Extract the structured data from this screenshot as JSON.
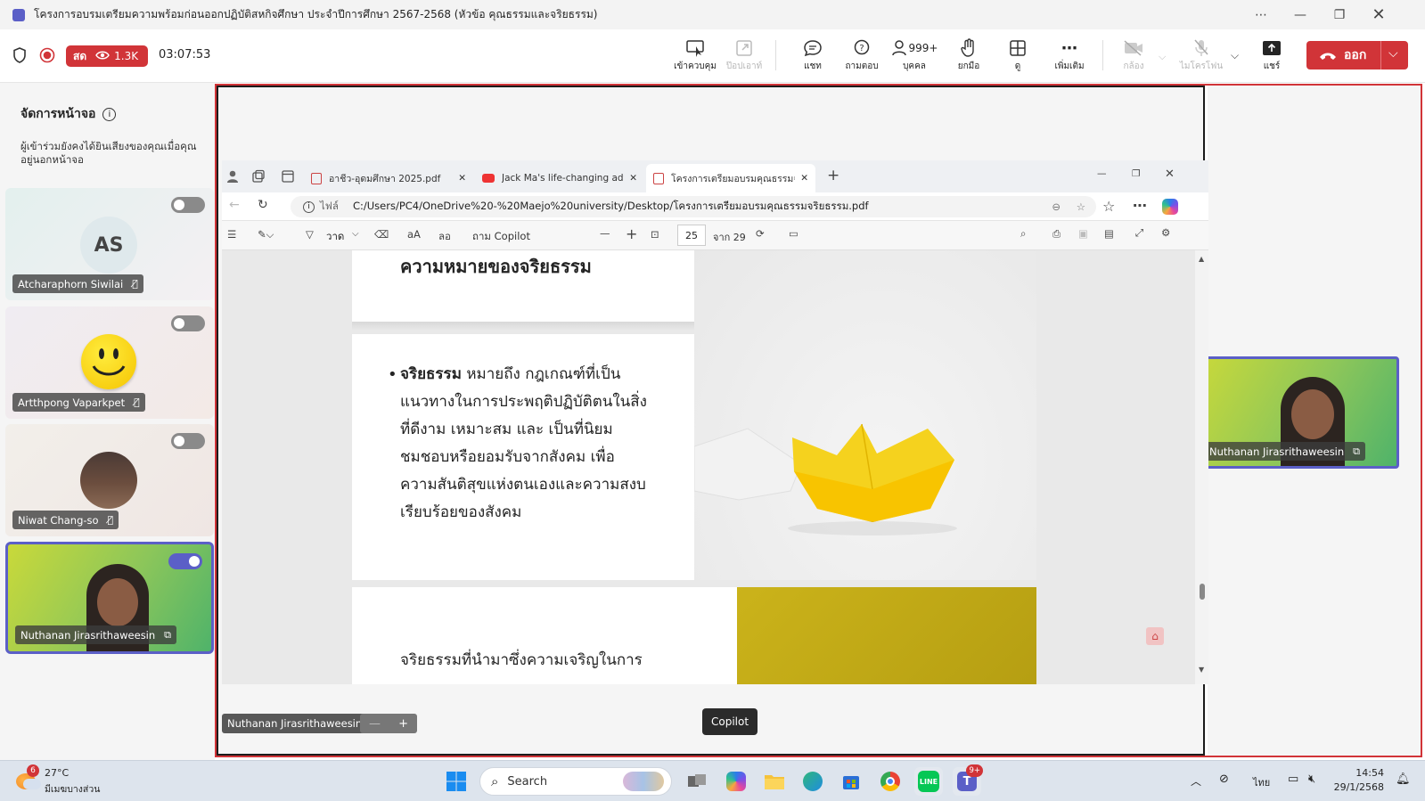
{
  "window": {
    "title": "โครงการอบรมเตรียมความพร้อมก่อนออกปฏิบัติสหกิจศึกษา ประจำปีการศึกษา 2567-2568 (หัวข้อ คุณธรรมและจริยธรรม)"
  },
  "meeting": {
    "live_label": "สด",
    "viewers": "1.3K",
    "timer": "03:07:53",
    "buttons": {
      "control": "เข้าควบคุม",
      "popout": "ป๊อปเอาท์",
      "chat": "แชท",
      "qa": "ถามตอบ",
      "people_count": "999+",
      "people": "บุคคล",
      "raise_hand": "ยกมือ",
      "view": "ดู",
      "more": "เพิ่มเติม",
      "camera": "กล้อง",
      "mic": "ไมโครโฟน",
      "share": "แชร์",
      "leave": "ออก"
    }
  },
  "left_panel": {
    "title": "จัดการหน้าจอ",
    "description": "ผู้เข้าร่วมยังคงได้ยินเสียงของคุณเมื่อคุณอยู่นอกหน้าจอ",
    "participants": [
      {
        "name": "Atcharaphorn Siwilai",
        "initials": "AS",
        "toggle_on": false
      },
      {
        "name": "Artthpong Vaparkpet",
        "toggle_on": false
      },
      {
        "name": "Niwat Chang-so",
        "toggle_on": false
      },
      {
        "name": "Nuthanan Jirasrithaweesin",
        "toggle_on": true
      }
    ]
  },
  "stage": {
    "presenter_name": "Nuthanan Jirasrithaweesin",
    "zoom_minus": "—",
    "zoom_plus": "+",
    "tooltip": "Copilot"
  },
  "browser": {
    "tabs": [
      {
        "label": "อาชีว-อุดมศึกษา 2025.pdf"
      },
      {
        "label": "Jack Ma's life-changing advice fo"
      },
      {
        "label": "โครงการเตรียมอบรมคุณธรรมจริยธรร"
      }
    ],
    "address_prefix": "ไฟล์",
    "url": "C:/Users/PC4/OneDrive%20-%20Maejo%20university/Desktop/โครงการเตรียมอบรมคุณธรรมจริยธรรม.pdf",
    "pdf_toolbar": {
      "draw": "วาด",
      "read_aloud": "aA",
      "translate": "ลอ",
      "copilot": "ถาม Copilot",
      "page": "25",
      "of_pages": "จาก 29"
    },
    "slide": {
      "heading": "ความหมายของจริยธรรม",
      "bullet_term": "จริยธรรม",
      "bullet_lines": [
        "หมายถึง กฎเกณฑ์ที่เป็น",
        "แนวทางในการประพฤติปฏิบัติตนในสิ่ง",
        "ที่ดีงาม เหมาะสม และ เป็นที่นิยม",
        "ชมชอบหรือยอมรับจากสังคม เพื่อ",
        "ความสันติสุขแห่งตนเองและความสงบ",
        "เรียบร้อยของสังคม"
      ],
      "next_slide_text": "จริยธรรมที่นำมาซึ่งความเจริญในการ"
    }
  },
  "right_panel": {
    "presenter_name": "Nuthanan Jirasrithaweesin"
  },
  "taskbar": {
    "weather_temp": "27°C",
    "weather_desc": "มีเมฆบางส่วน",
    "weather_badge": "6",
    "search_placeholder": "Search",
    "teams_badge": "9+",
    "language": "ไทย",
    "time": "14:54",
    "date": "29/1/2568"
  },
  "colors": {
    "accent": "#5b5fc7",
    "leave": "#d13438",
    "live": "#d13438"
  }
}
